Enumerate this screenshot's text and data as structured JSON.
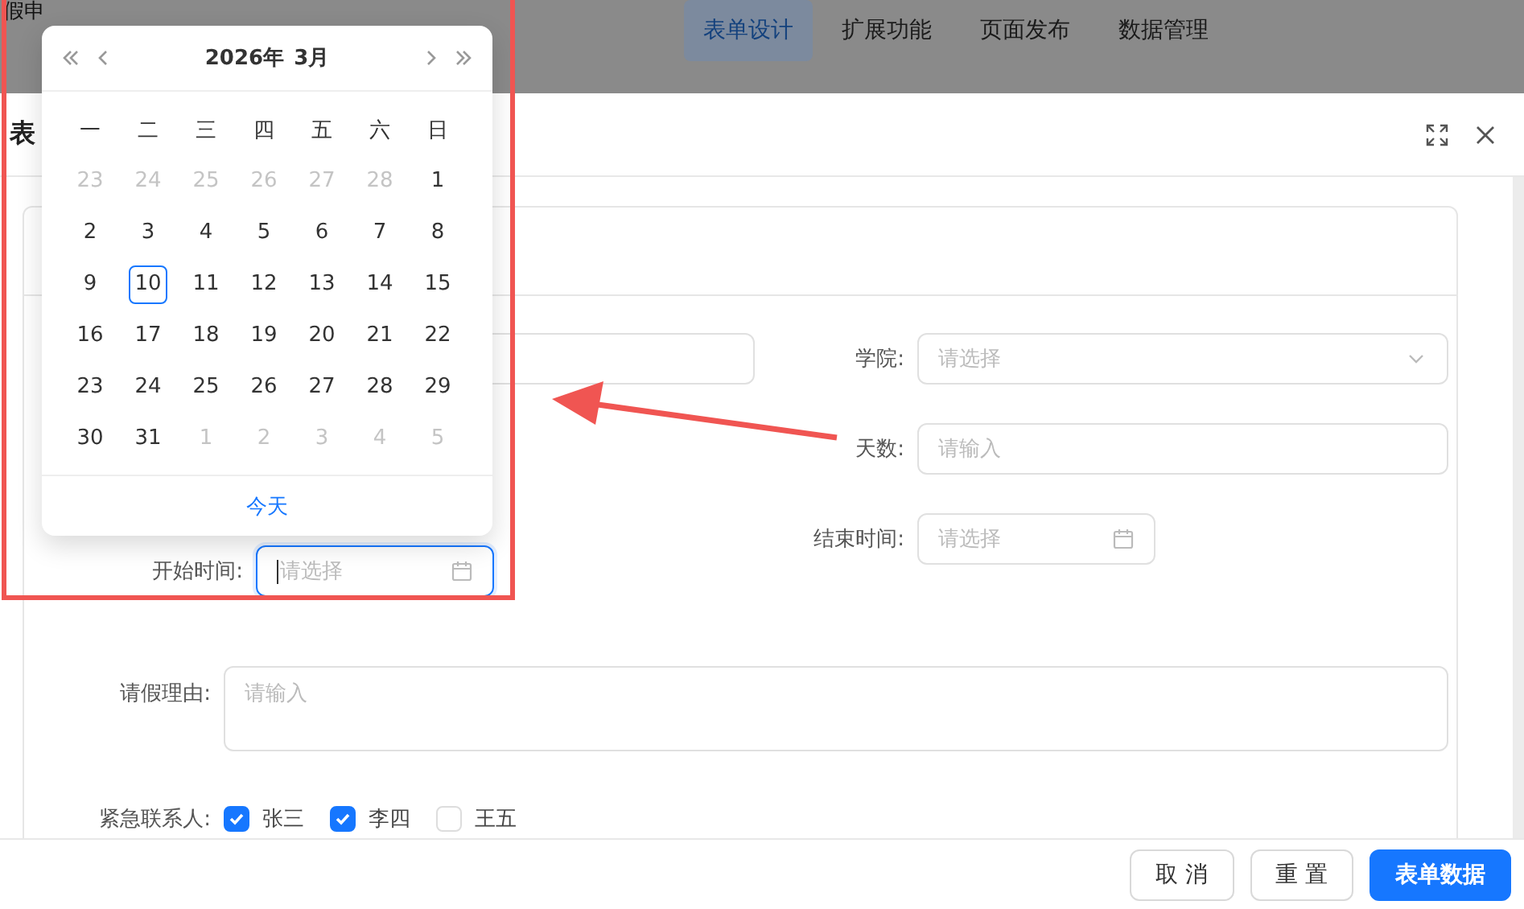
{
  "app_bar": {
    "title": "假申",
    "tabs": [
      {
        "label": "表单设计",
        "selected": true
      },
      {
        "label": "扩展功能",
        "selected": false
      },
      {
        "label": "页面发布",
        "selected": false
      },
      {
        "label": "数据管理",
        "selected": false
      }
    ]
  },
  "dialog": {
    "title": "表",
    "buttons": [
      {
        "label": "取 消",
        "kind": "default"
      },
      {
        "label": "重 置",
        "kind": "default"
      },
      {
        "label": "表单数据",
        "kind": "primary"
      }
    ]
  },
  "form": {
    "rows": [
      {
        "left": {
          "kind": "input"
        },
        "right": {
          "kind": "select",
          "label": "学院:",
          "placeholder": "请选择"
        }
      },
      {
        "right": {
          "kind": "input",
          "label": "天数:",
          "placeholder": "请输入"
        }
      },
      {
        "left": {
          "kind": "date",
          "label": "开始时间:",
          "placeholder": "请选择",
          "focused": true
        },
        "right": {
          "kind": "date",
          "label": "结束时间:",
          "placeholder": "请选择",
          "focused": false
        }
      }
    ],
    "reason": {
      "label": "请假理由:",
      "placeholder": "请输入"
    },
    "contacts": {
      "label": "紧急联系人:",
      "options": [
        {
          "label": "张三",
          "checked": true
        },
        {
          "label": "李四",
          "checked": true
        },
        {
          "label": "王五",
          "checked": false
        }
      ]
    }
  },
  "date_picker": {
    "year": "2026年",
    "month": "3月",
    "weekdays": [
      "一",
      "二",
      "三",
      "四",
      "五",
      "六",
      "日"
    ],
    "days": [
      {
        "label": "23",
        "in_month": false,
        "selected": false
      },
      {
        "label": "24",
        "in_month": false,
        "selected": false
      },
      {
        "label": "25",
        "in_month": false,
        "selected": false
      },
      {
        "label": "26",
        "in_month": false,
        "selected": false
      },
      {
        "label": "27",
        "in_month": false,
        "selected": false
      },
      {
        "label": "28",
        "in_month": false,
        "selected": false
      },
      {
        "label": "1",
        "in_month": true,
        "selected": false
      },
      {
        "label": "2",
        "in_month": true,
        "selected": false
      },
      {
        "label": "3",
        "in_month": true,
        "selected": false
      },
      {
        "label": "4",
        "in_month": true,
        "selected": false
      },
      {
        "label": "5",
        "in_month": true,
        "selected": false
      },
      {
        "label": "6",
        "in_month": true,
        "selected": false
      },
      {
        "label": "7",
        "in_month": true,
        "selected": false
      },
      {
        "label": "8",
        "in_month": true,
        "selected": false
      },
      {
        "label": "9",
        "in_month": true,
        "selected": false
      },
      {
        "label": "10",
        "in_month": true,
        "selected": true
      },
      {
        "label": "11",
        "in_month": true,
        "selected": false
      },
      {
        "label": "12",
        "in_month": true,
        "selected": false
      },
      {
        "label": "13",
        "in_month": true,
        "selected": false
      },
      {
        "label": "14",
        "in_month": true,
        "selected": false
      },
      {
        "label": "15",
        "in_month": true,
        "selected": false
      },
      {
        "label": "16",
        "in_month": true,
        "selected": false
      },
      {
        "label": "17",
        "in_month": true,
        "selected": false
      },
      {
        "label": "18",
        "in_month": true,
        "selected": false
      },
      {
        "label": "19",
        "in_month": true,
        "selected": false
      },
      {
        "label": "20",
        "in_month": true,
        "selected": false
      },
      {
        "label": "21",
        "in_month": true,
        "selected": false
      },
      {
        "label": "22",
        "in_month": true,
        "selected": false
      },
      {
        "label": "23",
        "in_month": true,
        "selected": false
      },
      {
        "label": "24",
        "in_month": true,
        "selected": false
      },
      {
        "label": "25",
        "in_month": true,
        "selected": false
      },
      {
        "label": "26",
        "in_month": true,
        "selected": false
      },
      {
        "label": "27",
        "in_month": true,
        "selected": false
      },
      {
        "label": "28",
        "in_month": true,
        "selected": false
      },
      {
        "label": "29",
        "in_month": true,
        "selected": false
      },
      {
        "label": "30",
        "in_month": true,
        "selected": false
      },
      {
        "label": "31",
        "in_month": true,
        "selected": false
      },
      {
        "label": "1",
        "in_month": false,
        "selected": false
      },
      {
        "label": "2",
        "in_month": false,
        "selected": false
      },
      {
        "label": "3",
        "in_month": false,
        "selected": false
      },
      {
        "label": "4",
        "in_month": false,
        "selected": false
      },
      {
        "label": "5",
        "in_month": false,
        "selected": false
      }
    ],
    "today_link": "今天"
  }
}
